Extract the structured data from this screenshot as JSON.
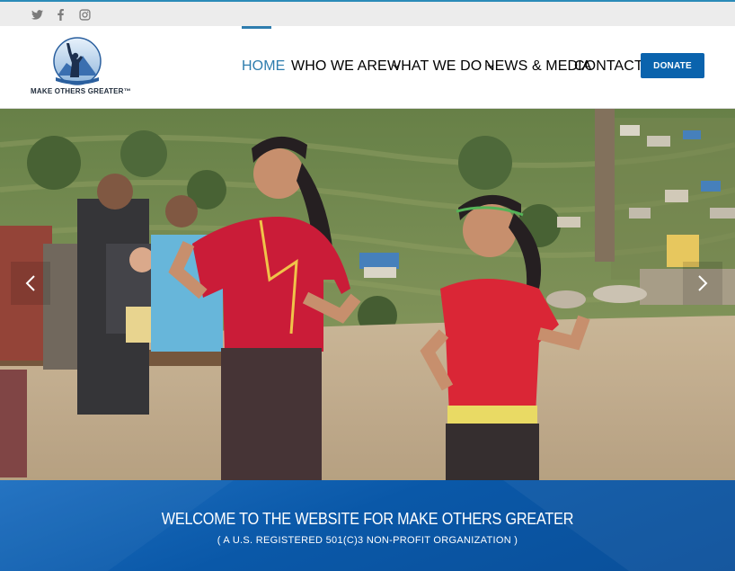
{
  "social": {
    "icons": [
      "twitter-icon",
      "facebook-icon",
      "instagram-icon"
    ]
  },
  "brand": {
    "logo_text": "MAKE OTHERS GREATER™"
  },
  "nav": {
    "home": "HOME",
    "who_we_are": "WHO WE ARE",
    "what_we_do": "WHAT WE DO",
    "news_media": "NEWS & MEDIA",
    "contact": "CONTACT",
    "donate": "DONATE"
  },
  "slider": {
    "prev_icon": "chevron-left-icon",
    "next_icon": "chevron-right-icon"
  },
  "banner": {
    "title": "WELCOME TO THE WEBSITE FOR MAKE OTHERS GREATER",
    "subtitle": "( A U.S. REGISTERED 501(C)3 NON-PROFIT ORGANIZATION )"
  },
  "colors": {
    "accent": "#2e7dae",
    "donate_bg": "#0a63ad",
    "banner_bg": "#0a58a8",
    "topbar_bg": "#ececec"
  }
}
